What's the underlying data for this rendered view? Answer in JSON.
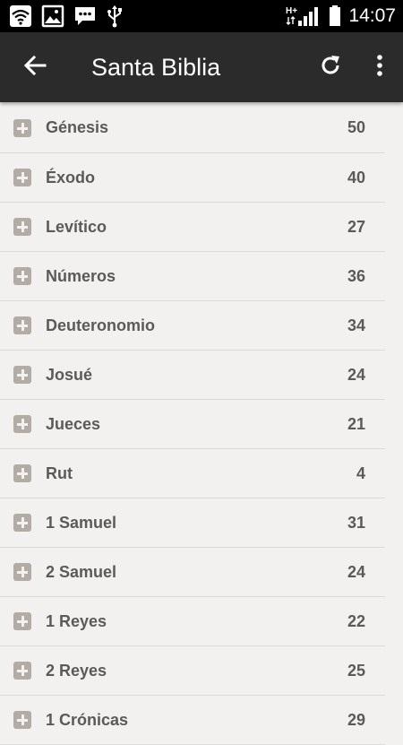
{
  "status_bar": {
    "network": "H+",
    "time": "14:07"
  },
  "app_bar": {
    "title": "Santa Biblia"
  },
  "books": [
    {
      "name": "Génesis",
      "chapters": "50"
    },
    {
      "name": "Éxodo",
      "chapters": "40"
    },
    {
      "name": "Levítico",
      "chapters": "27"
    },
    {
      "name": "Números",
      "chapters": "36"
    },
    {
      "name": "Deuteronomio",
      "chapters": "34"
    },
    {
      "name": "Josué",
      "chapters": "24"
    },
    {
      "name": "Jueces",
      "chapters": "21"
    },
    {
      "name": "Rut",
      "chapters": "4"
    },
    {
      "name": "1 Samuel",
      "chapters": "31"
    },
    {
      "name": "2 Samuel",
      "chapters": "24"
    },
    {
      "name": "1 Reyes",
      "chapters": "22"
    },
    {
      "name": "2 Reyes",
      "chapters": "25"
    },
    {
      "name": "1 Crónicas",
      "chapters": "29"
    }
  ],
  "colors": {
    "app_bar": "#2b2b2b",
    "background": "#f2f1ef",
    "expand_icon": "#b3aca4",
    "text": "#5a5a5a"
  }
}
